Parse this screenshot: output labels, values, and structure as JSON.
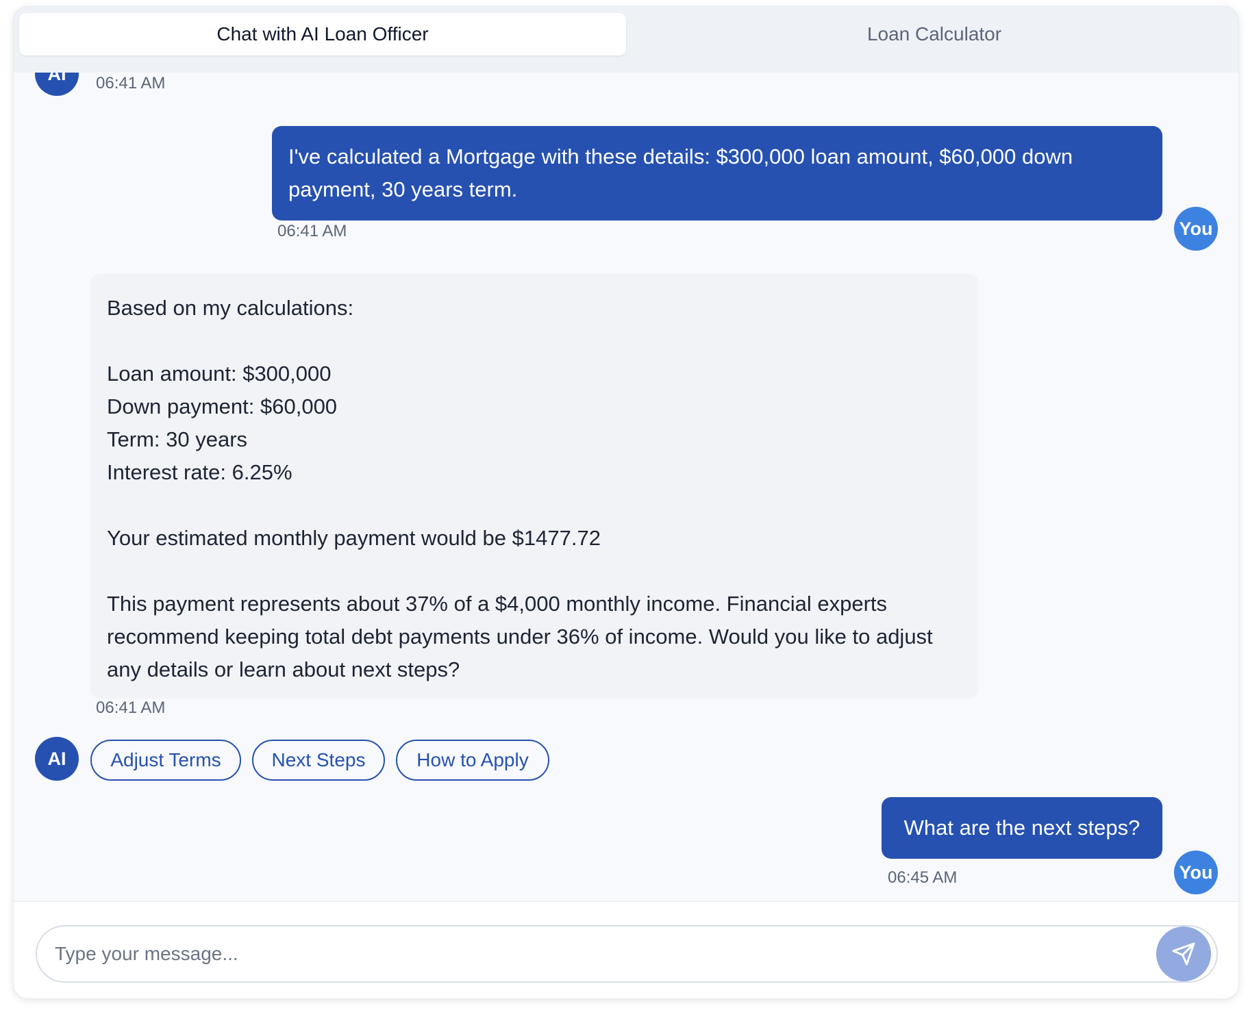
{
  "tabs": [
    {
      "label": "Chat with AI Loan Officer",
      "active": true
    },
    {
      "label": "Loan Calculator",
      "active": false
    }
  ],
  "avatars": {
    "ai": "AI",
    "user": "You"
  },
  "messages": [
    {
      "sender": "ai",
      "time": "06:41 AM"
    },
    {
      "sender": "user",
      "text": "I've calculated a Mortgage with these details: $300,000 loan amount, $60,000 down payment, 30 years term.",
      "time": "06:41 AM"
    },
    {
      "sender": "ai",
      "text": "Based on my calculations:\n\nLoan amount: $300,000\nDown payment: $60,000\nTerm: 30 years\nInterest rate: 6.25%\n\nYour estimated monthly payment would be $1477.72\n\nThis payment represents about 37% of a $4,000 monthly income. Financial experts recommend keeping total debt payments under 36% of income. Would you like to adjust any details or learn about next steps?",
      "time": "06:41 AM"
    },
    {
      "sender": "user",
      "text": "What are the next steps?",
      "time": "06:45 AM"
    }
  ],
  "quick_replies": [
    "Adjust Terms",
    "Next Steps",
    "How to Apply"
  ],
  "composer": {
    "placeholder": "Type your message...",
    "send_icon": "paper-plane-icon"
  },
  "colors": {
    "primary": "#2651b0",
    "user_avatar": "#3d82e0",
    "send_button": "#92aae0",
    "ai_bubble": "#f1f3f7",
    "background": "#f7f9fc"
  }
}
